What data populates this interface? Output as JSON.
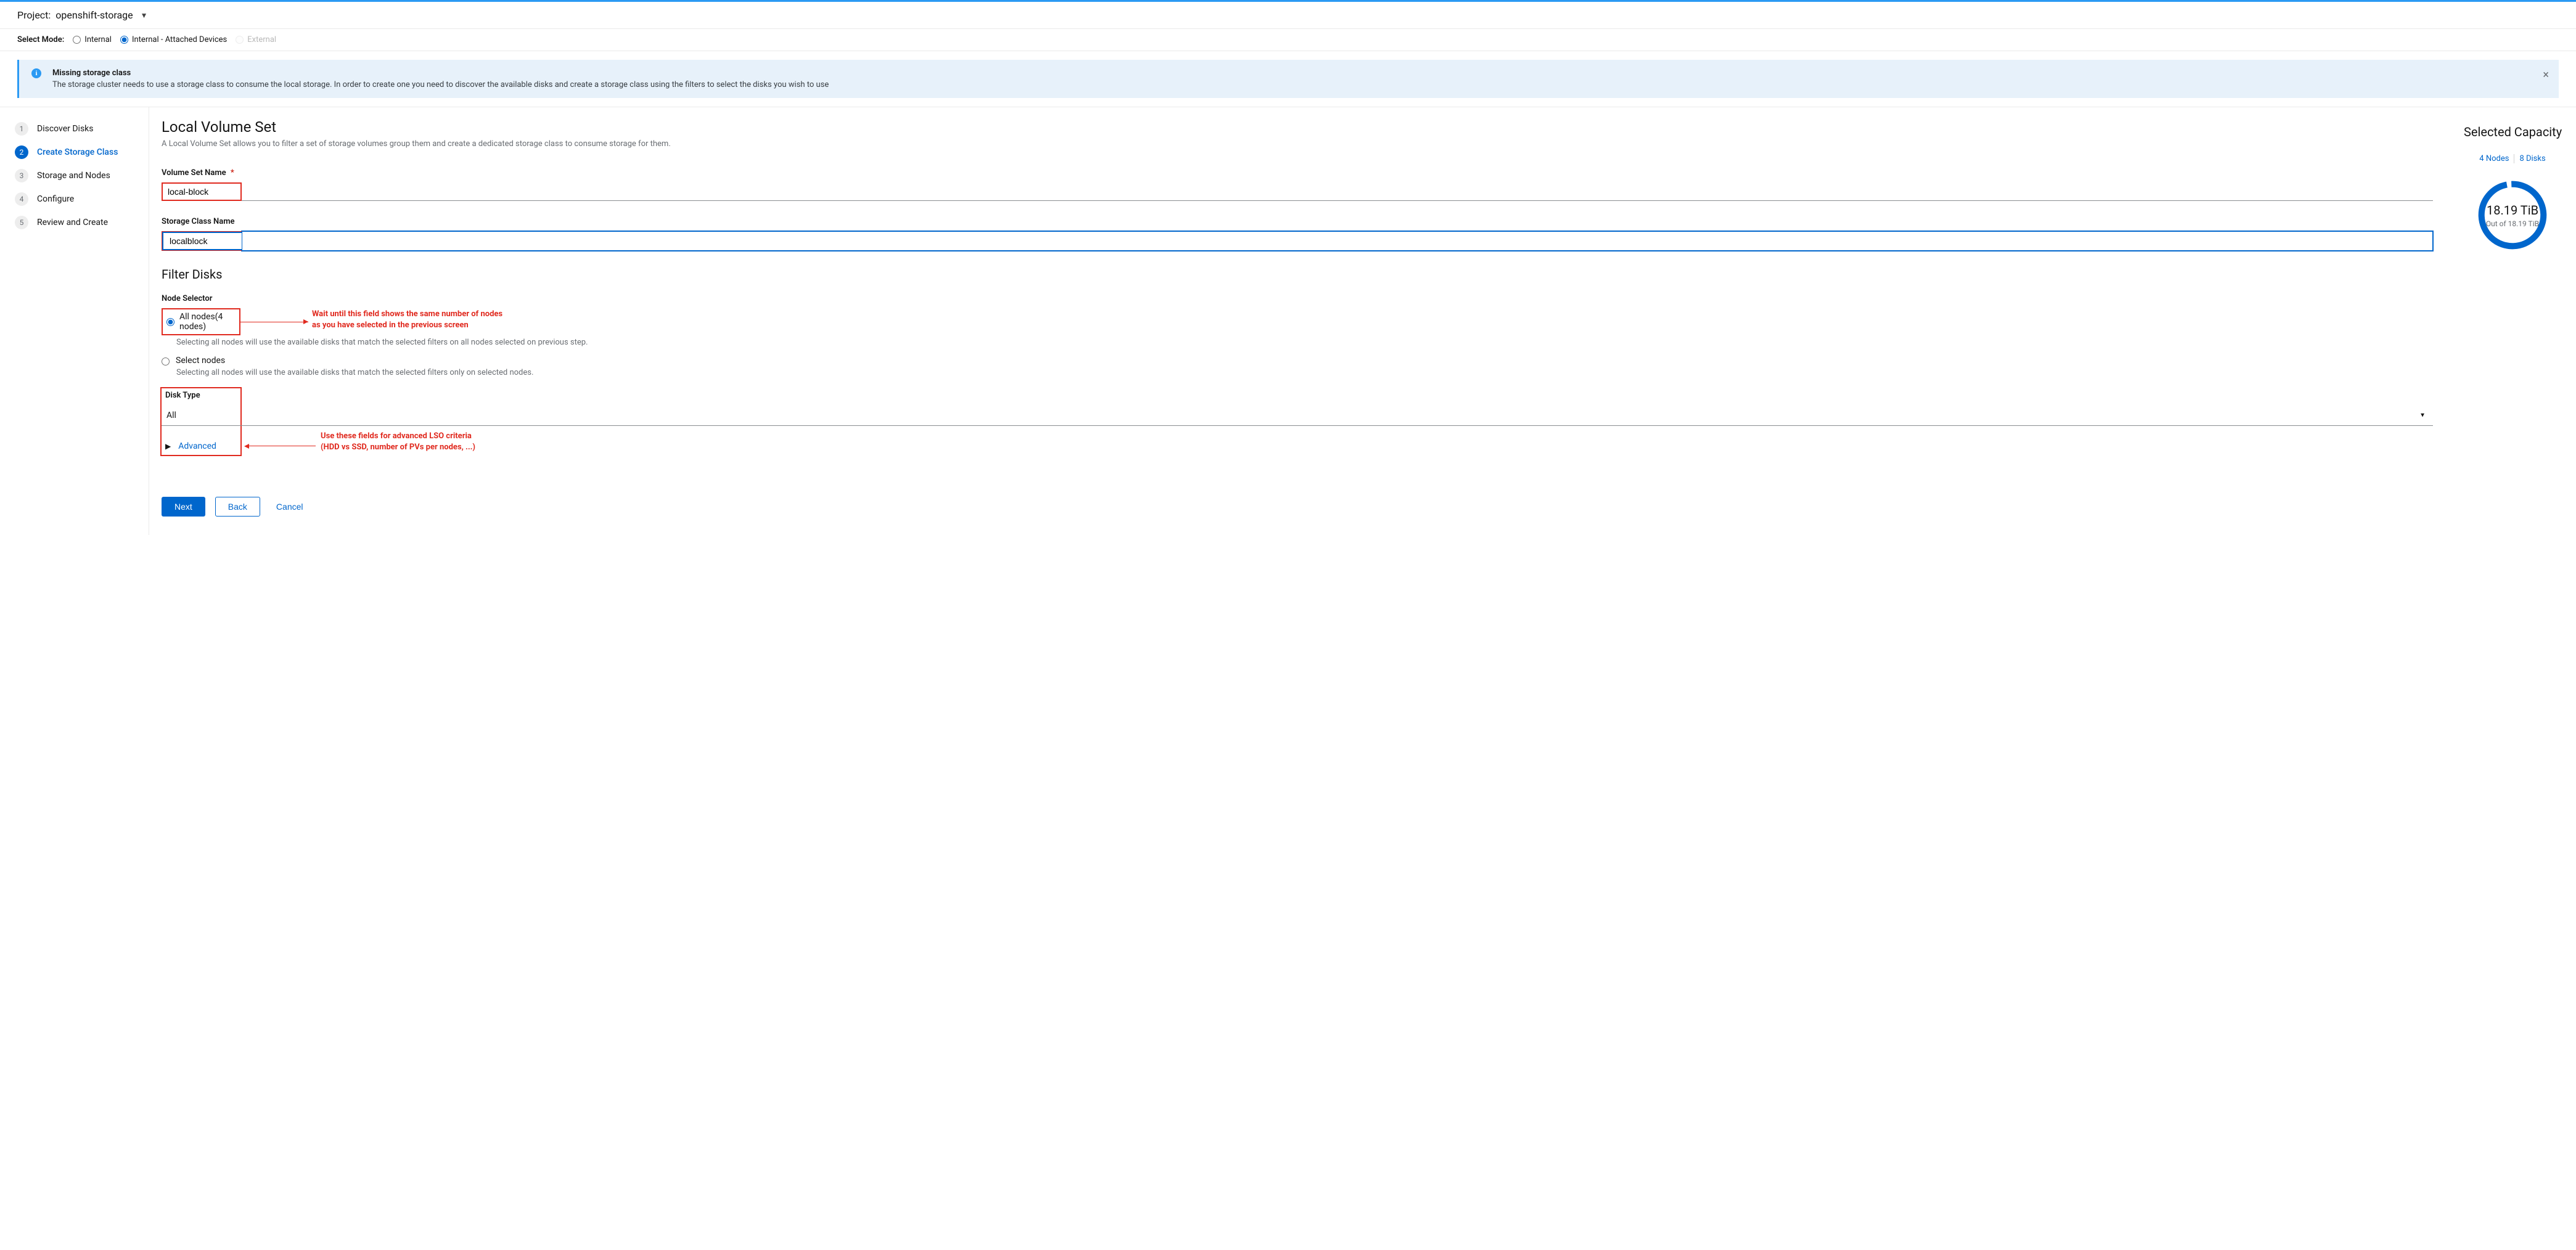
{
  "project_bar": {
    "prefix": "Project:",
    "value": "openshift-storage"
  },
  "mode": {
    "label": "Select Mode:",
    "options": {
      "internal": "Internal",
      "internal_attached": "Internal - Attached Devices",
      "external": "External"
    }
  },
  "alert": {
    "title": "Missing storage class",
    "body": "The storage cluster needs to use a storage class to consume the local storage. In order to create one you need to discover the available disks and create a storage class using the filters to select the disks you wish to use"
  },
  "steps": [
    {
      "num": "1",
      "label": "Discover Disks"
    },
    {
      "num": "2",
      "label": "Create Storage Class"
    },
    {
      "num": "3",
      "label": "Storage and Nodes"
    },
    {
      "num": "4",
      "label": "Configure"
    },
    {
      "num": "5",
      "label": "Review and Create"
    }
  ],
  "main": {
    "title": "Local Volume Set",
    "subtitle": "A Local Volume Set allows you to filter a set of storage volumes group them and create a dedicated storage class to consume storage for them.",
    "vol_name_label": "Volume Set Name",
    "vol_name_value": "local-block",
    "sc_name_label": "Storage Class Name",
    "sc_name_value": "localblock",
    "filter_title": "Filter Disks",
    "node_selector_label": "Node Selector",
    "all_nodes_label": "All nodes(4 nodes)",
    "all_nodes_help": "Selecting all nodes will use the available disks that match the selected filters on all nodes selected on previous step.",
    "select_nodes_label": "Select nodes",
    "select_nodes_help": "Selecting all nodes will use the available disks that match the selected filters only on selected nodes.",
    "disk_type_label": "Disk Type",
    "disk_type_value": "All",
    "advanced_label": "Advanced"
  },
  "annotations": {
    "nodes_line1": "Wait until this field shows the same number of nodes",
    "nodes_line2": "as you have selected in the previous screen",
    "disk_line1": "Use these fields for advanced LSO criteria",
    "disk_line2": "(HDD vs SSD, number of PVs per nodes, ...)"
  },
  "buttons": {
    "next": "Next",
    "back": "Back",
    "cancel": "Cancel"
  },
  "capacity": {
    "title": "Selected Capacity",
    "nodes_link": "4 Nodes",
    "disks_link": "8 Disks",
    "value": "18.19 TiB",
    "sub": "Out of 18.19 TiB"
  }
}
